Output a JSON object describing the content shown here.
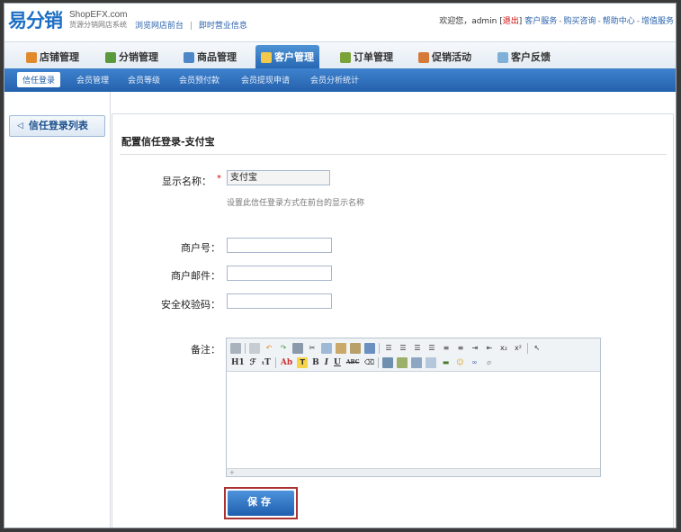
{
  "header": {
    "logo_text": "易分销",
    "site": "ShopEFX.com",
    "tagline": "货源分销网店系统",
    "links": [
      "浏览网店前台",
      "即时营业信息"
    ]
  },
  "user_bar": {
    "welcome": "欢迎您，admin",
    "logout": "退出",
    "links": [
      "客户服务",
      "购买咨询",
      "帮助中心",
      "增值服务"
    ]
  },
  "main_nav": {
    "tabs": [
      {
        "label": "店铺管理",
        "icon": "house-icon"
      },
      {
        "label": "分销管理",
        "icon": "people-icon"
      },
      {
        "label": "商品管理",
        "icon": "goods-icon"
      },
      {
        "label": "客户管理",
        "icon": "customer-icon"
      },
      {
        "label": "订单管理",
        "icon": "order-icon"
      },
      {
        "label": "促销活动",
        "icon": "promo-icon"
      },
      {
        "label": "客户反馈",
        "icon": "feedback-icon"
      }
    ],
    "active": "客户管理"
  },
  "sub_nav": {
    "items": [
      "信任登录",
      "会员管理",
      "会员等级",
      "会员预付款",
      "会员提现申请",
      "会员分析统计"
    ],
    "active": "信任登录"
  },
  "sidebar": {
    "back_label": "信任登录列表"
  },
  "form": {
    "title": "配置信任登录-支付宝",
    "display_name": {
      "label": "显示名称：",
      "required_mark": "*",
      "value": "支付宝",
      "hint": "设置此信任登录方式在前台的显示名称"
    },
    "merchant_id": {
      "label": "商户号：",
      "value": ""
    },
    "merchant_email": {
      "label": "商户邮件：",
      "value": ""
    },
    "security_code": {
      "label": "安全校验码：",
      "value": ""
    },
    "remark": {
      "label": "备注："
    },
    "editor_toolbar": {
      "heading": "H1",
      "font": "ℱ",
      "size": "ₜT",
      "abc": "Ab",
      "bold": "B",
      "italic": "I",
      "underline": "U",
      "strike": "ABC"
    },
    "save_label": "保存"
  },
  "colors": {
    "primary": "#2566b1",
    "accent_red": "#cc0000",
    "nav_bg": "#e3ebf3"
  }
}
